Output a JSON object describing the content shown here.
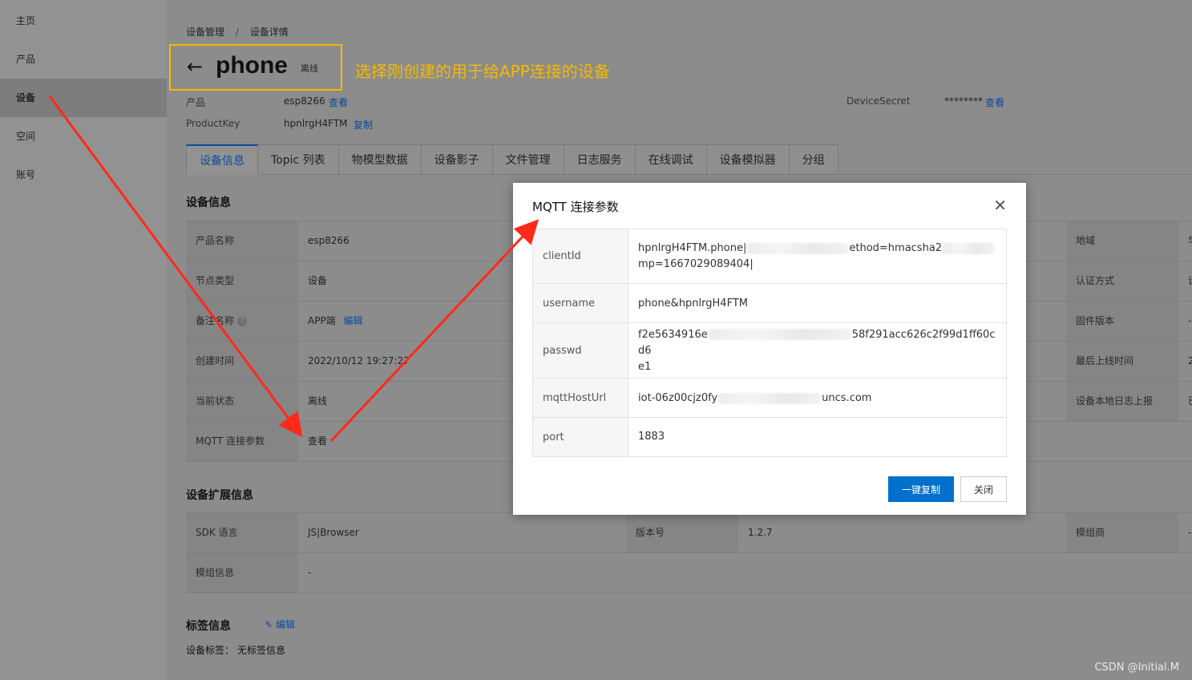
{
  "sidebar": {
    "items": [
      {
        "label": "主页"
      },
      {
        "label": "产品"
      },
      {
        "label": "设备"
      },
      {
        "label": "空间"
      },
      {
        "label": "账号"
      }
    ]
  },
  "breadcrumb": {
    "parent": "设备管理",
    "separator": "/",
    "current": "设备详情"
  },
  "header": {
    "back_icon": "←",
    "device_name": "phone",
    "status": "离线"
  },
  "annotation": "选择刚创建的用于给APP连接的设备",
  "meta": {
    "product_label": "产品",
    "product_value": "esp8266",
    "product_link": "查看",
    "productkey_label": "ProductKey",
    "productkey_value": "hpnlrgH4FTM",
    "productkey_link": "复制",
    "secret_label": "DeviceSecret",
    "secret_value": "********",
    "secret_link": "查看"
  },
  "tabs": [
    "设备信息",
    "Topic 列表",
    "物模型数据",
    "设备影子",
    "文件管理",
    "日志服务",
    "在线调试",
    "设备模拟器",
    "分组"
  ],
  "device_info": {
    "title": "设备信息",
    "rows": [
      {
        "label": "产品名称",
        "value": "esp8266",
        "right_label": "地域",
        "right_value": "华"
      },
      {
        "label": "节点类型",
        "value": "设备",
        "right_label": "认证方式",
        "right_value": "设"
      },
      {
        "label": "备注名称",
        "value": "APP端",
        "link": "编辑",
        "right_label": "固件版本",
        "right_value": "-"
      },
      {
        "label": "创建时间",
        "value": "2022/10/12 19:27:27",
        "right_label": "最后上线时间",
        "right_value": "2"
      },
      {
        "label": "当前状态",
        "value": "离线",
        "right_label": "设备本地日志上报",
        "right_value": "已"
      },
      {
        "label": "MQTT 连接参数",
        "link": "查看"
      }
    ]
  },
  "ext_info": {
    "title": "设备扩展信息",
    "rows": [
      {
        "label": "SDK 语言",
        "value": "JS|Browser",
        "mid_label": "版本号",
        "mid_value": "1.2.7",
        "right_label": "模组商",
        "right_value": "-"
      },
      {
        "label": "模组信息",
        "value": "-"
      }
    ]
  },
  "tags": {
    "title": "标签信息",
    "edit": "编辑",
    "label": "设备标签：",
    "value": "无标签信息"
  },
  "modal": {
    "title": "MQTT 连接参数",
    "close_icon": "✕",
    "rows": [
      {
        "label": "clientId",
        "value_a": "hpnlrgH4FTM.phone|",
        "value_b": "ethod=hmacsha2",
        "value_c": "mp=1667029089404|"
      },
      {
        "label": "username",
        "value_a": "phone&hpnlrgH4FTM"
      },
      {
        "label": "passwd",
        "value_a": "f2e5634916e",
        "value_b": "58f291acc626c2f99d1ff60cd6",
        "value_c": "e1"
      },
      {
        "label": "mqttHostUrl",
        "value_a": "iot-06z00cjz0fy",
        "value_b": "uncs.com"
      },
      {
        "label": "port",
        "value_a": "1883"
      }
    ],
    "copy_button": "一键复制",
    "close_button": "关闭"
  },
  "watermark": "CSDN @Initial.M",
  "colors": {
    "accent": "#0070cc",
    "annotation": "#f5b800",
    "arrow": "#ff2a1a"
  }
}
